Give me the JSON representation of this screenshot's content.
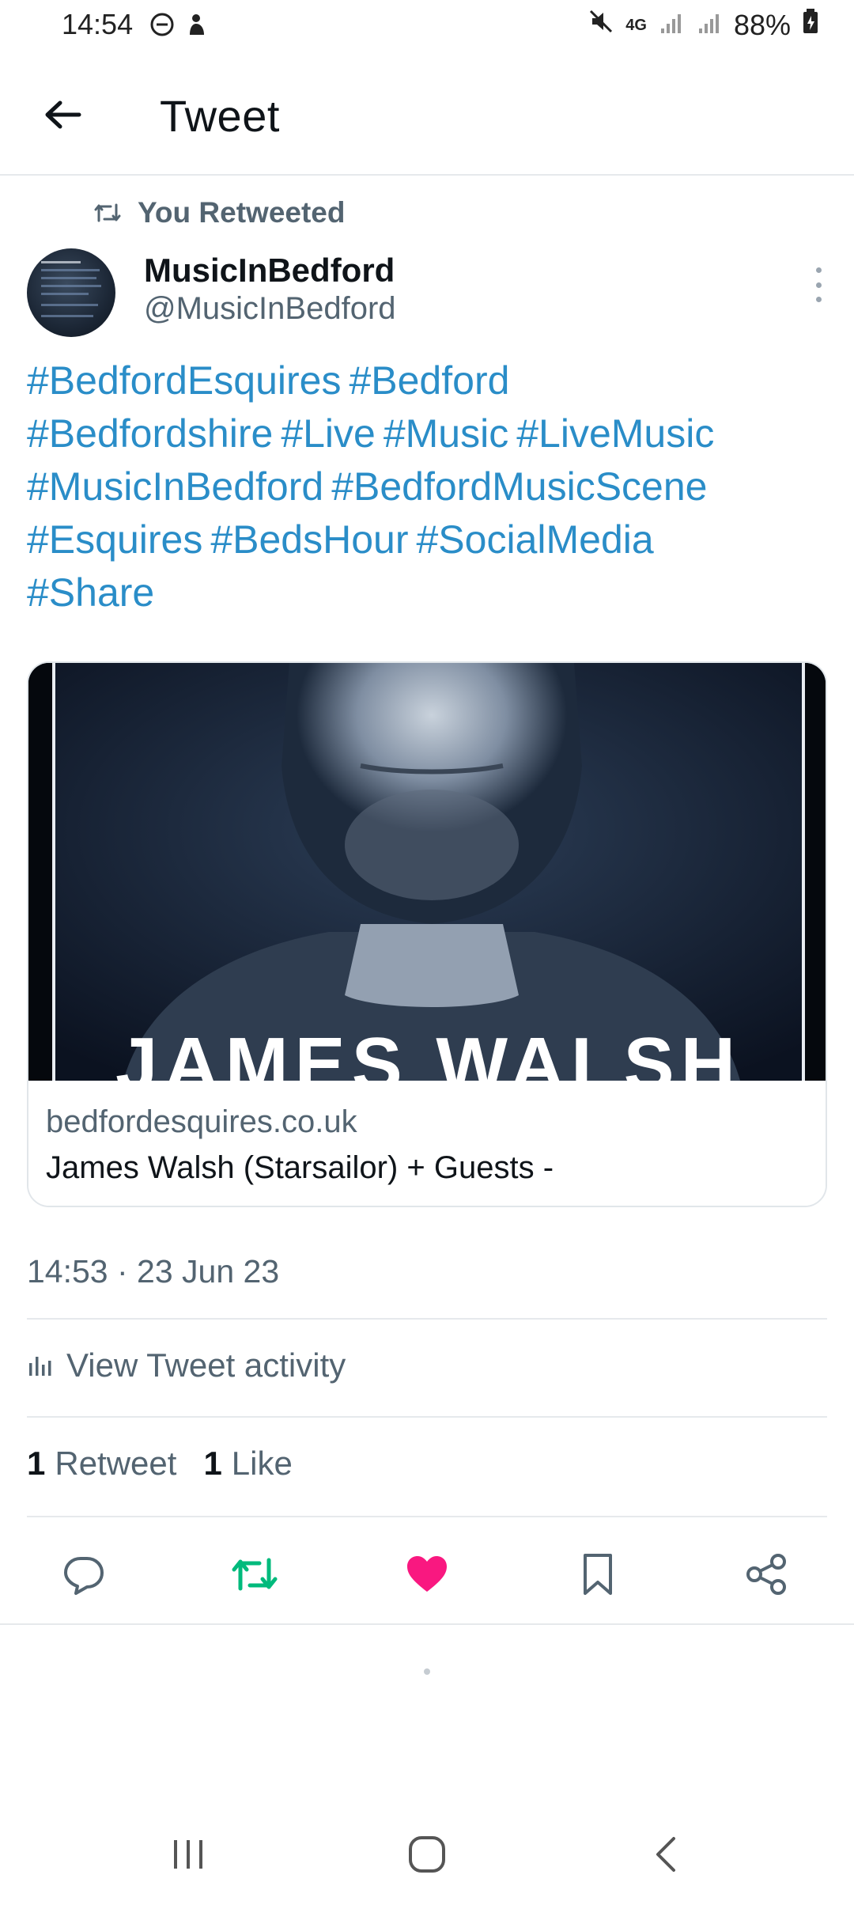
{
  "status_bar": {
    "time": "14:54",
    "network": "4G",
    "battery": "88%"
  },
  "header": {
    "title": "Tweet"
  },
  "retweet_banner": {
    "label": "You Retweeted"
  },
  "author": {
    "name": "MusicInBedford",
    "handle": "@MusicInBedford"
  },
  "tweet": {
    "hashtags": [
      "#BedfordEsquires",
      "#Bedford",
      "#Bedfordshire",
      "#Live",
      "#Music",
      "#LiveMusic",
      "#MusicInBedford",
      "#BedfordMusicScene",
      "#Esquires",
      "#BedsHour",
      "#SocialMedia",
      "#Share"
    ]
  },
  "card": {
    "image_caption": "JAMES WALSH",
    "domain": "bedfordesquires.co.uk",
    "title": "James Walsh (Starsailor) + Guests -"
  },
  "timestamp": "14:53 · 23 Jun 23",
  "activity_label": "View Tweet activity",
  "stats": {
    "retweets_count": "1",
    "retweets_label": "Retweet",
    "likes_count": "1",
    "likes_label": "Like"
  },
  "colors": {
    "link": "#2a8dc8",
    "retweet_active": "#00ba7c",
    "like_active": "#f91880",
    "secondary_text": "#536471"
  },
  "icons": {
    "back": "arrow-left-icon",
    "retweet_banner": "retweet-icon",
    "more": "more-vertical-icon",
    "activity": "bar-chart-icon",
    "reply": "reply-icon",
    "retweet": "retweet-icon",
    "like": "heart-icon",
    "bookmark": "bookmark-icon",
    "share": "share-icon"
  }
}
